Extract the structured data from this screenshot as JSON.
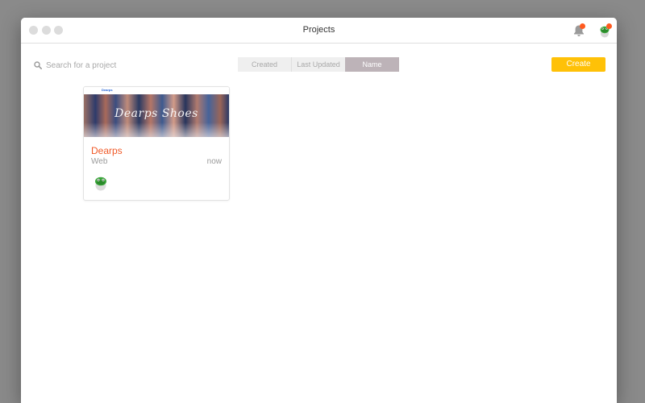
{
  "window": {
    "title": "Projects"
  },
  "toolbar": {
    "search_placeholder": "Search for a project",
    "sort_tabs": [
      {
        "label": "Created",
        "active": false
      },
      {
        "label": "Last Updated",
        "active": false
      },
      {
        "label": "Name",
        "active": true
      }
    ],
    "create_label": "Create"
  },
  "icons": {
    "search": "search-icon",
    "notifications": "bell-icon",
    "user": "user-avatar-icon"
  },
  "colors": {
    "accent": "#ffc107",
    "project_name": "#f05a28",
    "active_tab": "#bdb3b8",
    "notification_dot": "#ff5a1f"
  },
  "projects": [
    {
      "name": "Dearps",
      "type": "Web",
      "updated": "now",
      "thumbnail": {
        "logo": "Dearps",
        "headline": "Dearps Shoes"
      }
    }
  ]
}
